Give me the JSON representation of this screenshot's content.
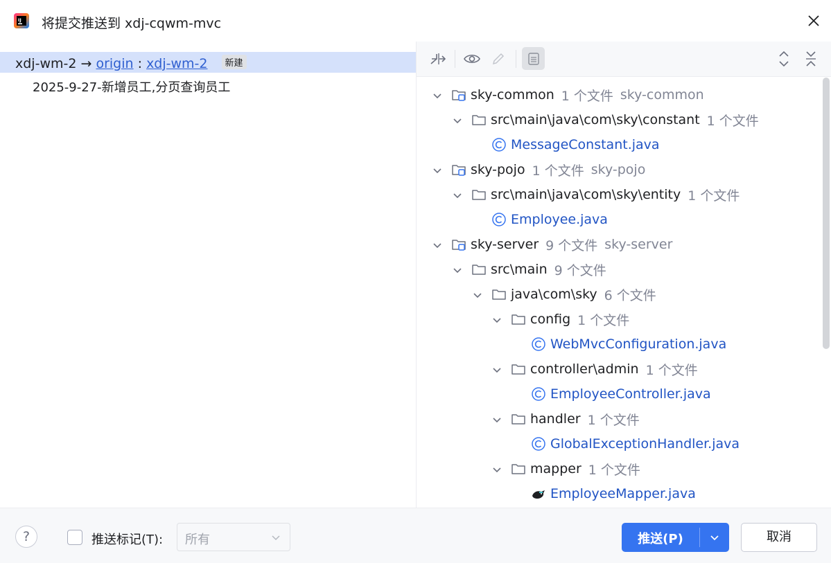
{
  "window": {
    "title": "将提交推送到 xdj-cqwm-mvc"
  },
  "left": {
    "branch": {
      "local": "xdj-wm-2",
      "arrow": "→",
      "remote": "origin",
      "colon": ":",
      "remote_branch": "xdj-wm-2",
      "badge": "新建"
    },
    "commit": "2025-9-27-新增员工,分页查询员工"
  },
  "toolbar": {
    "icons": [
      "merge-arrows-icon",
      "eye-icon",
      "pencil-icon",
      "group-by-icon",
      "expand-all-icon",
      "collapse-all-icon"
    ]
  },
  "tree": [
    {
      "type": "module",
      "name": "sky-common",
      "count": "1 个文件",
      "module": "sky-common"
    },
    {
      "type": "folder",
      "name": "src\\main\\java\\com\\sky\\constant",
      "count": "1 个文件"
    },
    {
      "type": "file",
      "name": "MessageConstant.java",
      "icon": "class-icon"
    },
    {
      "type": "module",
      "name": "sky-pojo",
      "count": "1 个文件",
      "module": "sky-pojo"
    },
    {
      "type": "folder",
      "name": "src\\main\\java\\com\\sky\\entity",
      "count": "1 个文件"
    },
    {
      "type": "file",
      "name": "Employee.java",
      "icon": "class-icon"
    },
    {
      "type": "module",
      "name": "sky-server",
      "count": "9 个文件",
      "module": "sky-server"
    },
    {
      "type": "folder",
      "name": "src\\main",
      "count": "9 个文件"
    },
    {
      "type": "folder",
      "name": "java\\com\\sky",
      "count": "6 个文件"
    },
    {
      "type": "folder",
      "name": "config",
      "count": "1 个文件"
    },
    {
      "type": "file",
      "name": "WebMvcConfiguration.java",
      "icon": "class-icon"
    },
    {
      "type": "folder",
      "name": "controller\\admin",
      "count": "1 个文件"
    },
    {
      "type": "file",
      "name": "EmployeeController.java",
      "icon": "class-icon"
    },
    {
      "type": "folder",
      "name": "handler",
      "count": "1 个文件"
    },
    {
      "type": "file",
      "name": "GlobalExceptionHandler.java",
      "icon": "class-icon"
    },
    {
      "type": "folder",
      "name": "mapper",
      "count": "1 个文件"
    },
    {
      "type": "file",
      "name": "EmployeeMapper.java",
      "icon": "mybatis-bird-icon"
    }
  ],
  "bottom": {
    "help": "?",
    "push_tags_label": "推送标记(T):",
    "tags_select_value": "所有",
    "push_button": "推送(P)",
    "cancel_button": "取消"
  },
  "colors": {
    "selection": "#d5e1fb",
    "link": "#2f5fd0",
    "file_blue": "#2154c4",
    "primary_button": "#3574f0"
  }
}
